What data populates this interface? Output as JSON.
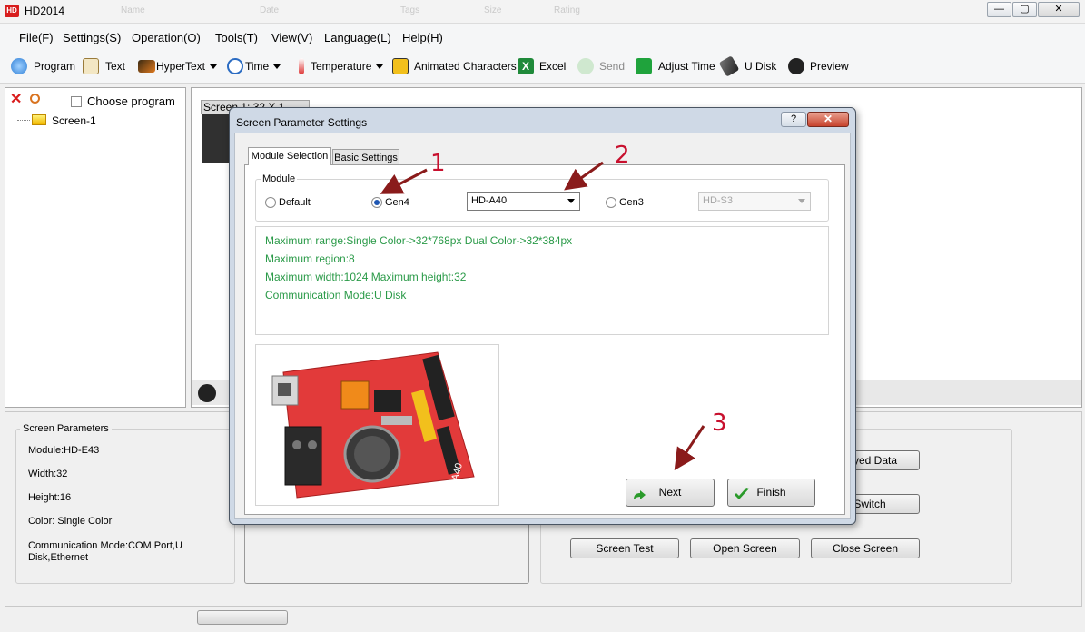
{
  "window": {
    "title": "HD2014",
    "ghost_headers": [
      "Name",
      "Date",
      "Tags",
      "Size",
      "Rating"
    ],
    "controls": {
      "minimize": "—",
      "maximize": "▢",
      "close": "✕"
    }
  },
  "menu": [
    "File(F)",
    "Settings(S)",
    "Operation(O)",
    "Tools(T)",
    "View(V)",
    "Language(L)",
    "Help(H)"
  ],
  "toolbar": {
    "program": "Program",
    "text": "Text",
    "hypertext": "HyperText",
    "time": "Time",
    "temperature": "Temperature",
    "animated": "Animated Characters",
    "excel": "Excel",
    "send": "Send",
    "adjust_time": "Adjust Time",
    "udisk": "U Disk",
    "preview": "Preview"
  },
  "left_panel": {
    "choose_program": "Choose program",
    "tree_item": "Screen-1"
  },
  "canvas": {
    "screen_tab": "Screen 1: 32 X 1"
  },
  "screen_params": {
    "title": "Screen Parameters",
    "module": "Module:HD-E43",
    "width": "Width:32",
    "height": "Height:16",
    "color": "Color: Single Color",
    "comm": "Communication Mode:COM Port,U Disk,Ethernet"
  },
  "bottom_buttons": {
    "displayed_data": "splayed Data",
    "switch": "e Switch",
    "screen_test": "Screen Test",
    "open_screen": "Open Screen",
    "close_screen": "Close Screen"
  },
  "dialog": {
    "title": "Screen Parameter Settings",
    "help": "?",
    "close": "✕",
    "tabs": [
      "Module Selection",
      "Basic Settings"
    ],
    "module_legend": "Module",
    "radio_default": "Default",
    "radio_gen4": "Gen4",
    "gen4_select": "HD-A40",
    "radio_gen3": "Gen3",
    "gen3_select": "HD-S3",
    "info": [
      "Maximum range:Single Color->32*768px  Dual Color->32*384px",
      "Maximum region:8",
      "Maximum width:1024 Maximum height:32",
      "Communication Mode:U Disk"
    ],
    "board_label": "A40",
    "next": "Next",
    "finish": "Finish"
  },
  "annotations": [
    "1",
    "2",
    "3"
  ],
  "colors": {
    "info_text": "#2a9a48",
    "annotation": "#c8102e",
    "board": "#e23a3a"
  }
}
